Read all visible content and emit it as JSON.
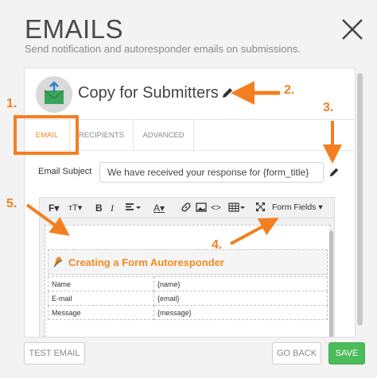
{
  "header": {
    "title": "EMAILS",
    "subtitle": "Send notification and autoresponder emails on submissions."
  },
  "form": {
    "name": "Copy for Submitters"
  },
  "tabs": [
    {
      "label": "EMAIL",
      "active": true
    },
    {
      "label": "RECIPIENTS",
      "active": false
    },
    {
      "label": "ADVANCED",
      "active": false
    }
  ],
  "subject": {
    "label": "Email Subject",
    "value": "We have received your response for {form_title}"
  },
  "toolbar": {
    "form_fields_label": "Form Fields"
  },
  "email_body": {
    "heading": "Creating a Form Autoresponder",
    "rows": [
      {
        "label": "Name",
        "value": "{name}"
      },
      {
        "label": "E-mail",
        "value": "{email}"
      },
      {
        "label": "Message",
        "value": "{message}"
      }
    ]
  },
  "annotations": {
    "n1": "1.",
    "n2": "2.",
    "n3": "3.",
    "n4": "4.",
    "n5": "5."
  },
  "footer": {
    "test_label": "TEST EMAIL",
    "back_label": "GO BACK",
    "save_label": "SAVE"
  },
  "colors": {
    "accent": "#f08a24",
    "annotation": "#f47f20",
    "save": "#4cbb5a"
  }
}
